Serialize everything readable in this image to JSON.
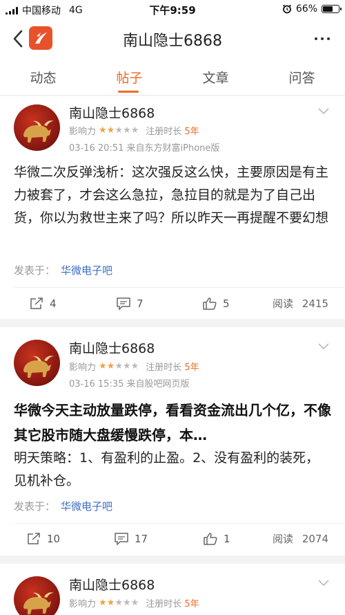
{
  "status_bar": {
    "carrier": "中国移动",
    "network": "4G",
    "time": "下午9:59",
    "battery": "66%",
    "battery_level": 0.66
  },
  "nav": {
    "title": "南山隐士6868"
  },
  "tabs": [
    {
      "label": "动态"
    },
    {
      "label": "帖子"
    },
    {
      "label": "文章"
    },
    {
      "label": "问答"
    }
  ],
  "active_tab": "帖子",
  "posts": [
    {
      "author": "南山隐士6868",
      "influence_label": "影响力",
      "stars_filled": "★★",
      "stars_empty": "★★★",
      "reg_label": "注册时长",
      "reg_years": "5年",
      "time_source": "03-16 20:51  来自东方财富iPhone版",
      "body": "华微二次反弹浅析：这次强反这么快，主要原因是有主力被套了，才会这么急拉，急拉目的就是为了自己出货，你以为救世主来了吗？所以昨天一再提醒不要幻想",
      "board_label": "发表于：",
      "board_name": "华微电子吧",
      "shares": "4",
      "comments": "7",
      "likes": "5",
      "read_label": "阅读",
      "reads": "2415"
    },
    {
      "author": "南山隐士6868",
      "influence_label": "影响力",
      "stars_filled": "★★",
      "stars_empty": "★★★",
      "reg_label": "注册时长",
      "reg_years": "5年",
      "time_source": "03-16 15:35  来自股吧网页版",
      "title": "华微今天主动放量跌停，看看资金流出几个亿，不像其它股市随大盘缓慢跌停，本…",
      "body": "明天策略：1、有盈利的止盈。2、没有盈利的装死，见机补仓。",
      "board_label": "发表于：",
      "board_name": "华微电子吧",
      "shares": "10",
      "comments": "17",
      "likes": "1",
      "read_label": "阅读",
      "reads": "2074"
    },
    {
      "author": "南山隐士6868",
      "influence_label": "影响力",
      "stars_filled": "★★",
      "stars_empty": "★★★",
      "reg_label": "注册时长",
      "reg_years": "5年"
    }
  ],
  "colors": {
    "accent": "#ee6a26",
    "link": "#3b6cc4",
    "star": "#f0a33c"
  },
  "icons": [
    "back-arrow-icon",
    "app-logo-icon",
    "more-icon",
    "chevron-down-icon",
    "share-icon",
    "comment-icon",
    "like-icon"
  ]
}
